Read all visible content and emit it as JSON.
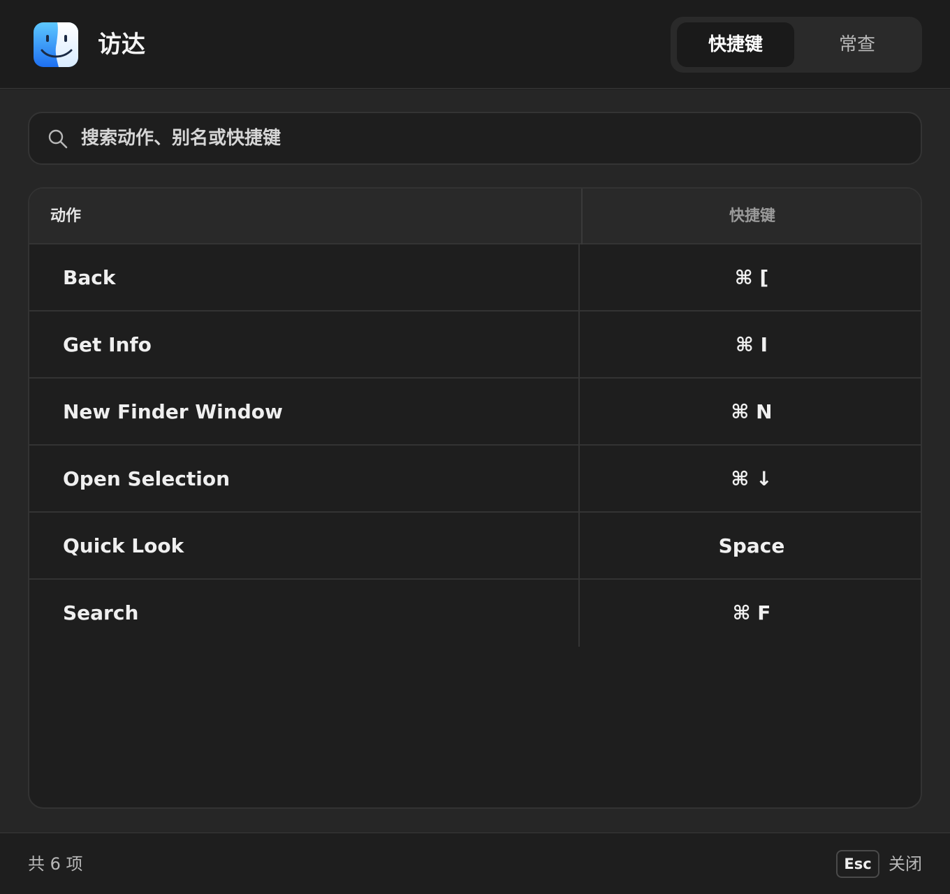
{
  "header": {
    "app_icon": "finder-icon",
    "title": "访达",
    "tabs": [
      {
        "label": "快捷键",
        "active": true
      },
      {
        "label": "常查",
        "active": false
      }
    ]
  },
  "search": {
    "icon": "search-icon",
    "placeholder": "搜索动作、别名或快捷键",
    "value": ""
  },
  "table": {
    "columns": {
      "action": "动作",
      "shortcut": "快捷键"
    },
    "rows": [
      {
        "action": "Back",
        "shortcut": "⌘ ["
      },
      {
        "action": "Get Info",
        "shortcut": "⌘ I"
      },
      {
        "action": "New Finder Window",
        "shortcut": "⌘ N"
      },
      {
        "action": "Open Selection",
        "shortcut": "⌘ ↓"
      },
      {
        "action": "Quick Look",
        "shortcut": "Space"
      },
      {
        "action": "Search",
        "shortcut": "⌘ F"
      }
    ]
  },
  "footer": {
    "count": "共 6 项",
    "esc_key": "Esc",
    "close_label": "关闭"
  },
  "colors": {
    "background": "#1e1e1e",
    "panel": "#262626",
    "finder_blue": "#1e8ff5",
    "finder_light_blue": "#5ec8ff"
  }
}
